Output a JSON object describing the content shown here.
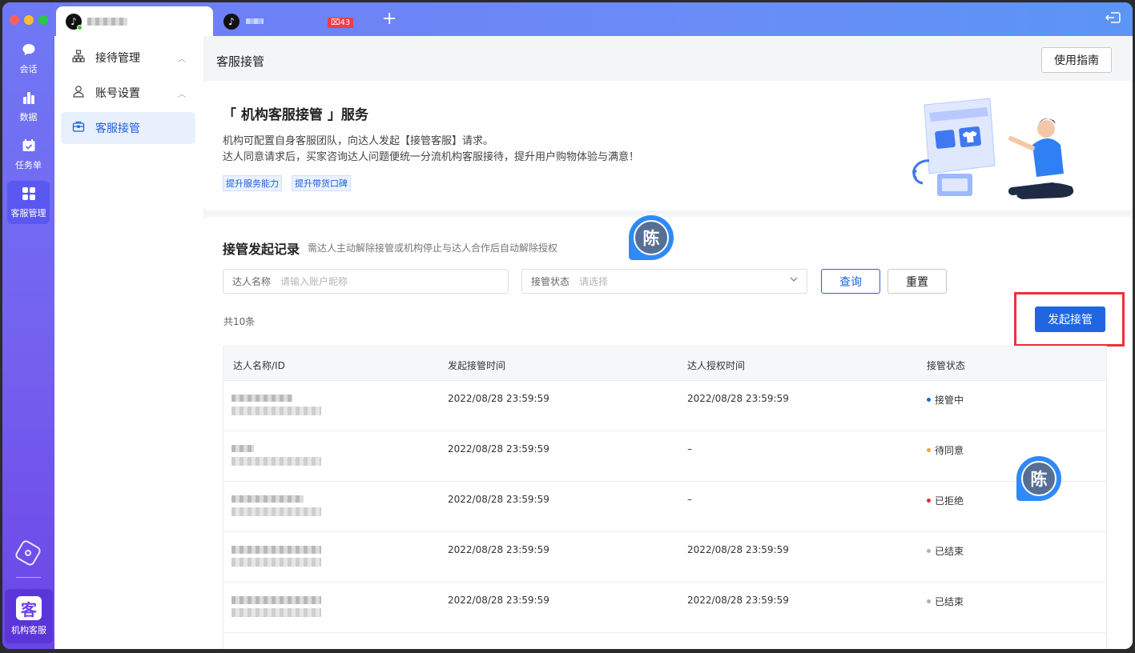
{
  "titlebar": {
    "tabs": [
      {
        "label": "",
        "active": true
      },
      {
        "label": ""
      }
    ],
    "badge": "43",
    "new_tab": "+"
  },
  "rail": {
    "items": [
      {
        "label": "会话",
        "icon": "chat-icon"
      },
      {
        "label": "数据",
        "icon": "bar-chart-icon"
      },
      {
        "label": "任务单",
        "icon": "calendar-check-icon"
      },
      {
        "label": "客服管理",
        "icon": "grid-icon"
      }
    ],
    "org": {
      "logo": "客",
      "label": "机构客服"
    }
  },
  "sidenav": {
    "items": [
      {
        "label": "接待管理",
        "icon": "org-chart-icon"
      },
      {
        "label": "账号设置",
        "icon": "user-icon"
      },
      {
        "label": "客服接管",
        "icon": "briefcase-icon"
      }
    ]
  },
  "page": {
    "title": "客服接管",
    "guide_button": "使用指南"
  },
  "banner": {
    "title": "「 机构客服接管 」服务",
    "line1": "机构可配置自身客服团队，向达人发起【接管客服】请求。",
    "line2": "达人同意请求后，买家咨询达人问题便统一分流机构客服接待，提升用户购物体验与满意！",
    "tags": [
      "提升服务能力",
      "提升带货口碑"
    ]
  },
  "records": {
    "title": "接管发起记录",
    "hint": "需达人主动解除接管或机构停止与达人合作后自动解除授权",
    "filters": {
      "name_label": "达人名称",
      "name_placeholder": "请输入账户昵称",
      "status_label": "接管状态",
      "status_placeholder": "请选择"
    },
    "query_button": "查询",
    "reset_button": "重置",
    "count": "共10条",
    "launch_button": "发起接管",
    "columns": [
      "达人名称/ID",
      "发起接管时间",
      "达人授权时间",
      "接管状态"
    ],
    "rows": [
      {
        "start": "2022/08/28 23:59:59",
        "auth": "2022/08/28 23:59:59",
        "status": "接管中",
        "status_color": "#1f66e0"
      },
      {
        "start": "2022/08/28 23:59:59",
        "auth": "–",
        "status": "待同意",
        "status_color": "#f5a24a"
      },
      {
        "start": "2022/08/28 23:59:59",
        "auth": "–",
        "status": "已拒绝",
        "status_color": "#e8253d"
      },
      {
        "start": "2022/08/28 23:59:59",
        "auth": "2022/08/28 23:59:59",
        "status": "已结束",
        "status_color": "#b0b0b0"
      },
      {
        "start": "2022/08/28 23:59:59",
        "auth": "2022/08/28 23:59:59",
        "status": "已结束",
        "status_color": "#b0b0b0"
      }
    ]
  },
  "floating_avatars": [
    "陈",
    "陈"
  ],
  "colors": {
    "primary": "#1f66e0",
    "highlight_box": "#ee2f3a",
    "rail": "#7460ef"
  }
}
